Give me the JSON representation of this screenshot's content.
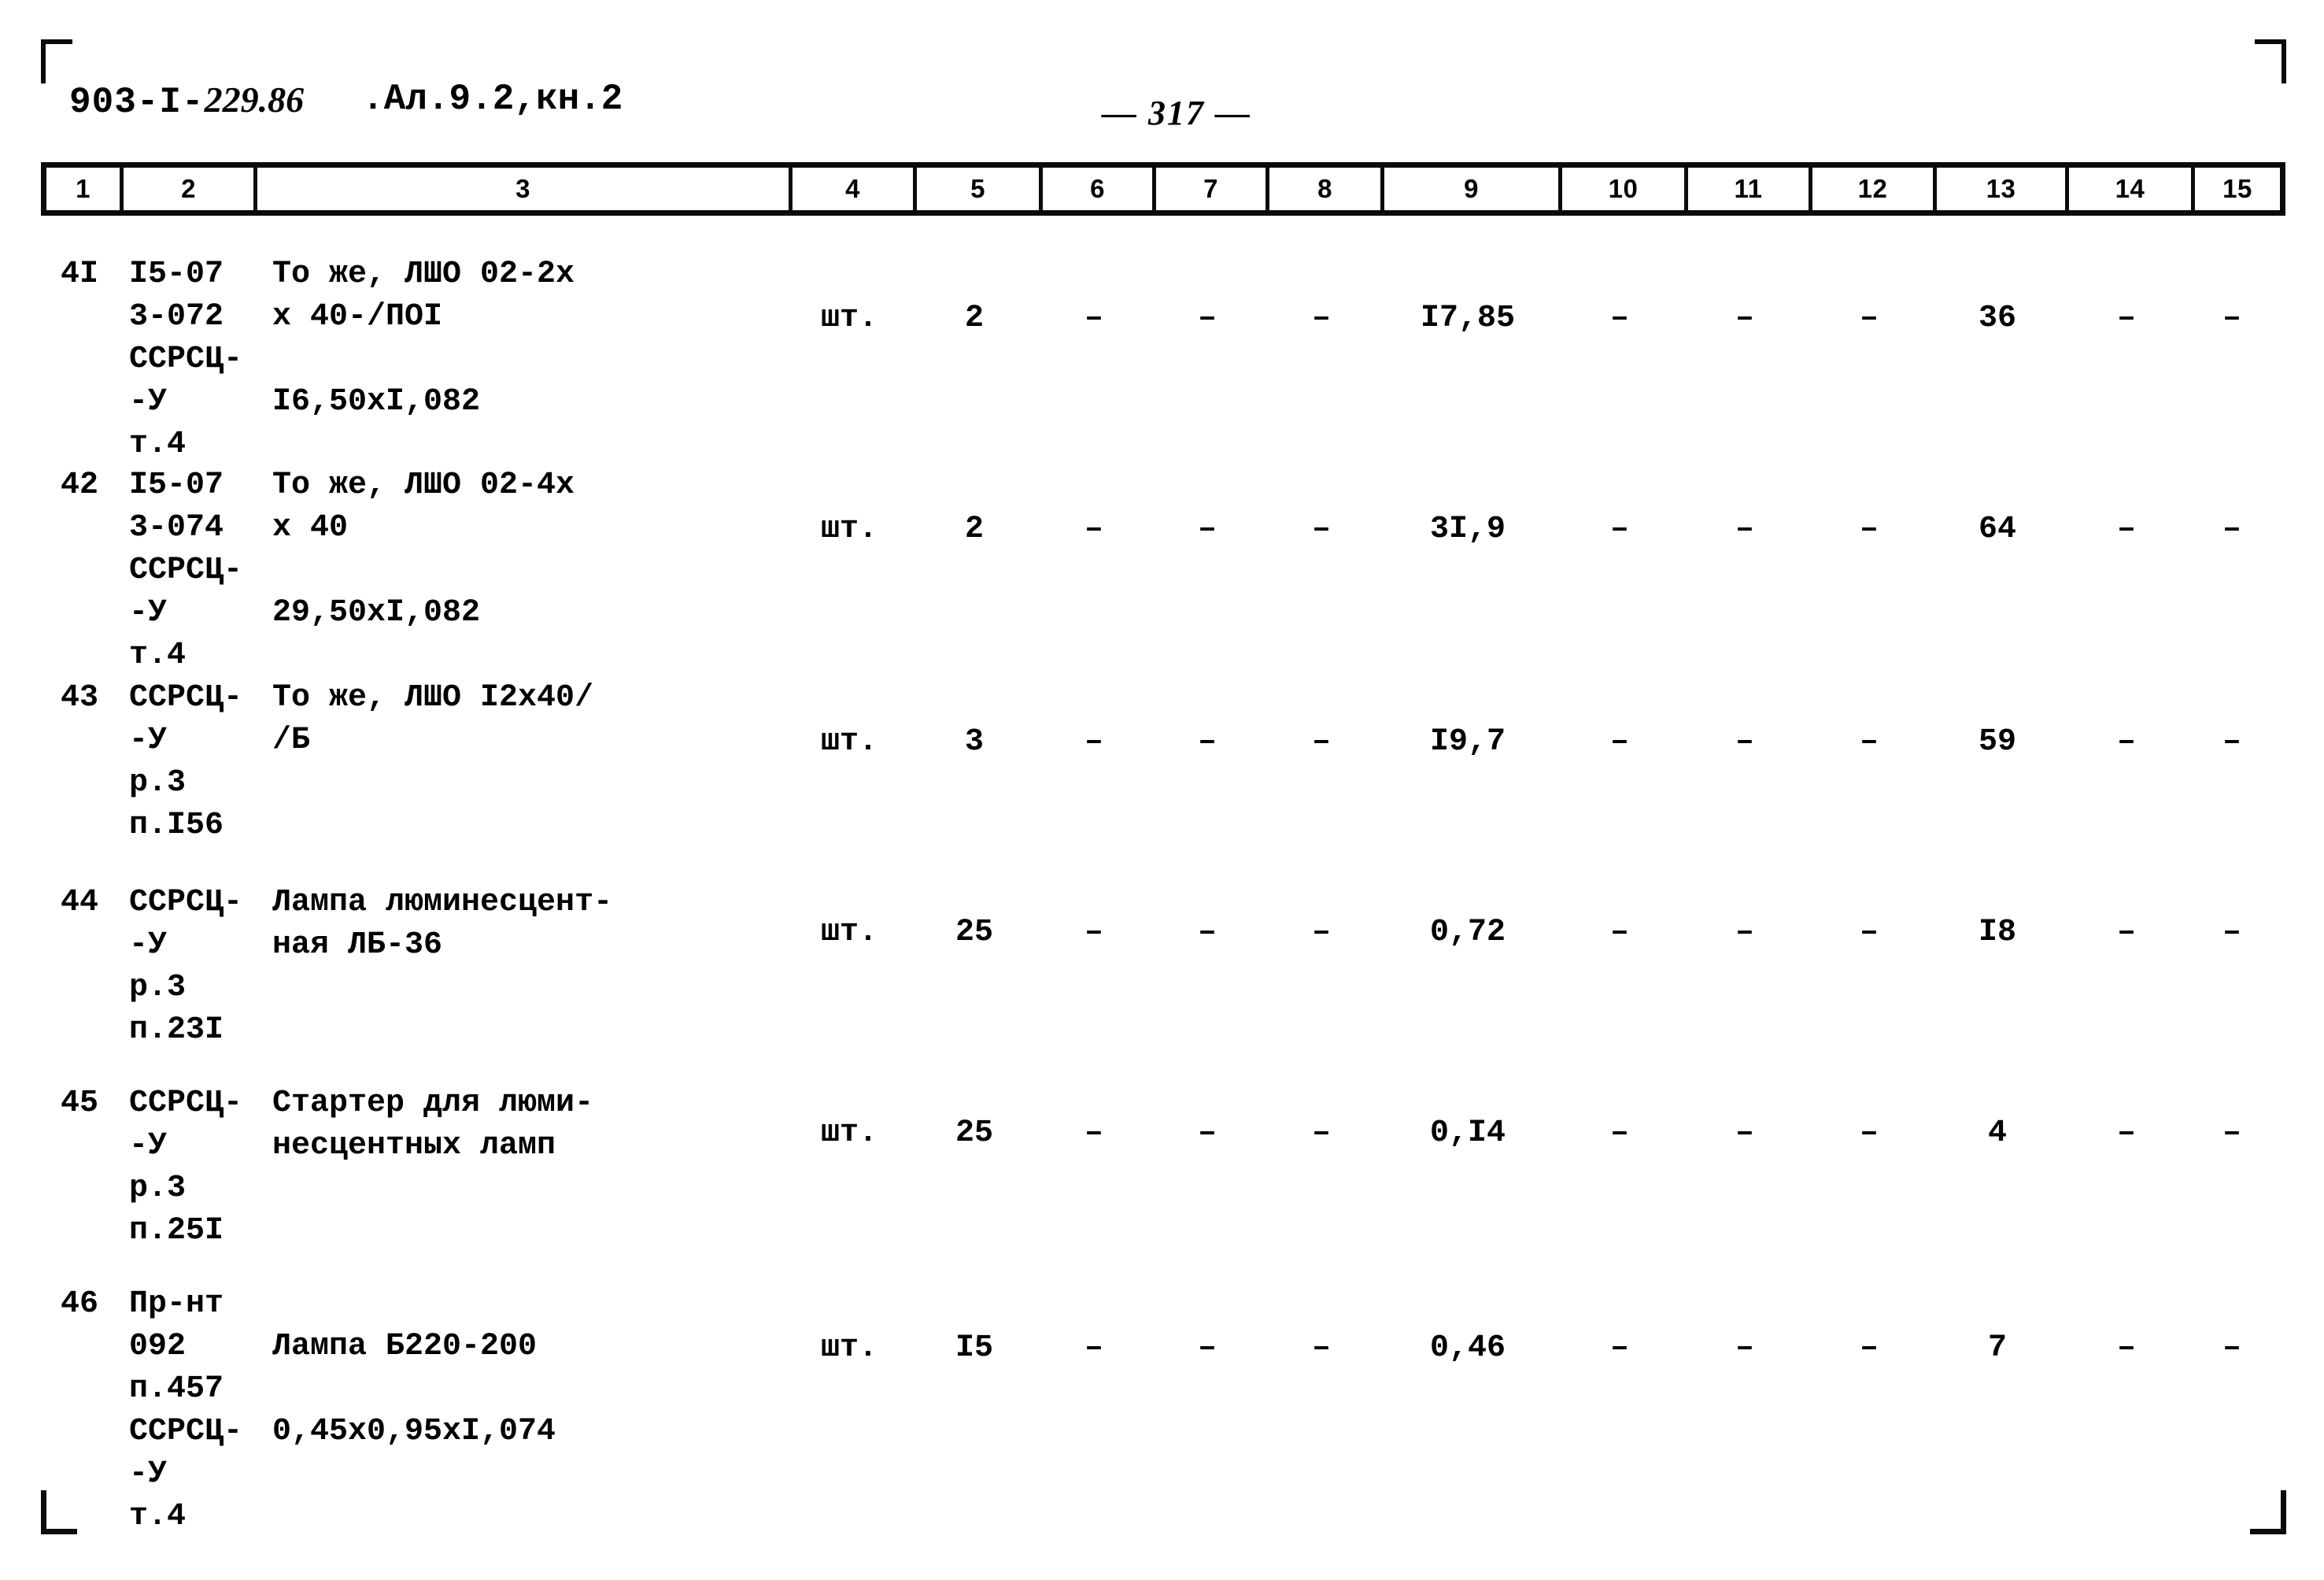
{
  "document": {
    "code_prefix": "903-I-",
    "code_italic": "229.86",
    "album": ".Ал.9.2,кн.2",
    "page_label": "— 317 —"
  },
  "table": {
    "column_headers": [
      "1",
      "2",
      "3",
      "4",
      "5",
      "6",
      "7",
      "8",
      "9",
      "10",
      "11",
      "12",
      "13",
      "14",
      "15"
    ],
    "rows": [
      {
        "num": "4I",
        "code_lines": [
          "I5-07",
          "3-072",
          "ССРСЦ-",
          "-У",
          "т.4"
        ],
        "desc_lines": [
          "То же, ЛШО 02-2х",
          "х 40-/ПОI",
          "",
          "I6,50хI,082",
          ""
        ],
        "unit": "шт.",
        "c5": "2",
        "c6": "–",
        "c7": "–",
        "c8": "–",
        "c9": "I7,85",
        "c10": "–",
        "c11": "–",
        "c12": "–",
        "c13": "36",
        "c14": "–",
        "c15": "–"
      },
      {
        "num": "42",
        "code_lines": [
          "I5-07",
          "3-074",
          "ССРСЦ-",
          "-У",
          "т.4"
        ],
        "desc_lines": [
          "То же, ЛШО 02-4х",
          "х 40",
          "",
          "29,50хI,082",
          ""
        ],
        "unit": "шт.",
        "c5": "2",
        "c6": "–",
        "c7": "–",
        "c8": "–",
        "c9": "3I,9",
        "c10": "–",
        "c11": "–",
        "c12": "–",
        "c13": "64",
        "c14": "–",
        "c15": "–"
      },
      {
        "num": "43",
        "code_lines": [
          "ССРСЦ-",
          "-У",
          "р.3",
          "п.I56"
        ],
        "desc_lines": [
          "То же, ЛШО I2х40/",
          "/Б",
          "",
          ""
        ],
        "unit": "шт.",
        "c5": "3",
        "c6": "–",
        "c7": "–",
        "c8": "–",
        "c9": "I9,7",
        "c10": "–",
        "c11": "–",
        "c12": "–",
        "c13": "59",
        "c14": "–",
        "c15": "–"
      },
      {
        "num": "44",
        "code_lines": [
          "ССРСЦ-",
          "-У",
          "р.3",
          "п.23I"
        ],
        "desc_lines": [
          "Лампа люминесцент-",
          "ная ЛБ-36",
          "",
          ""
        ],
        "unit": "шт.",
        "c5": "25",
        "c6": "–",
        "c7": "–",
        "c8": "–",
        "c9": "0,72",
        "c10": "–",
        "c11": "–",
        "c12": "–",
        "c13": "I8",
        "c14": "–",
        "c15": "–"
      },
      {
        "num": "45",
        "code_lines": [
          "ССРСЦ-",
          "-У",
          "р.3",
          "п.25I"
        ],
        "desc_lines": [
          "Стартер для люми-",
          "несцентных ламп",
          "",
          ""
        ],
        "unit": "шт.",
        "c5": "25",
        "c6": "–",
        "c7": "–",
        "c8": "–",
        "c9": "0,I4",
        "c10": "–",
        "c11": "–",
        "c12": "–",
        "c13": "4",
        "c14": "–",
        "c15": "–"
      },
      {
        "num": "46",
        "code_lines": [
          "Пр-нт",
          "092",
          "п.457",
          "ССРСЦ-",
          "-У",
          "т.4"
        ],
        "desc_lines": [
          "",
          "Лампа Б220-200",
          "",
          "0,45х0,95хI,074",
          "",
          ""
        ],
        "unit": "шт.",
        "c5": "I5",
        "c6": "–",
        "c7": "–",
        "c8": "–",
        "c9": "0,46",
        "c10": "–",
        "c11": "–",
        "c12": "–",
        "c13": "7",
        "c14": "–",
        "c15": "–"
      }
    ]
  }
}
